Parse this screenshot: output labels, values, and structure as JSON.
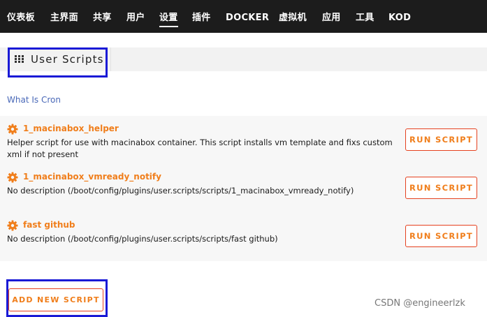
{
  "nav": {
    "items": [
      {
        "label": "仪表板"
      },
      {
        "label": "主界面"
      },
      {
        "label": "共享"
      },
      {
        "label": "用户"
      },
      {
        "label": "设置",
        "active": true
      },
      {
        "label": "插件"
      },
      {
        "label": "DOCKER"
      },
      {
        "label": "虚拟机"
      },
      {
        "label": "应用"
      },
      {
        "label": "工具"
      },
      {
        "label": "KOD"
      }
    ]
  },
  "page": {
    "title": "User Scripts",
    "title_icon": "grid-icon",
    "cron_link": "What Is Cron"
  },
  "scripts": [
    {
      "name": "1_macinabox_helper",
      "description": "Helper script for use with macinabox container. This script installs vm template and fixs custom xml if not present",
      "run_label": "RUN SCRIPT",
      "icon": "gear-icon"
    },
    {
      "name": "1_macinabox_vmready_notify",
      "description": "No description (/boot/config/plugins/user.scripts/scripts/1_macinabox_vmready_notify)",
      "run_label": "RUN SCRIPT",
      "icon": "gear-icon"
    },
    {
      "name": "fast github",
      "description": "No description (/boot/config/plugins/user.scripts/scripts/fast github)",
      "run_label": "RUN SCRIPT",
      "icon": "gear-icon"
    }
  ],
  "add_button": "ADD NEW SCRIPT",
  "watermark": "CSDN @engineerlzk",
  "colors": {
    "nav_bg": "#1c1c1c",
    "accent_orange": "#f07e1b",
    "button_border": "#e5411f",
    "link_blue": "#4a69b8",
    "highlight_box": "#1a1ad6"
  }
}
